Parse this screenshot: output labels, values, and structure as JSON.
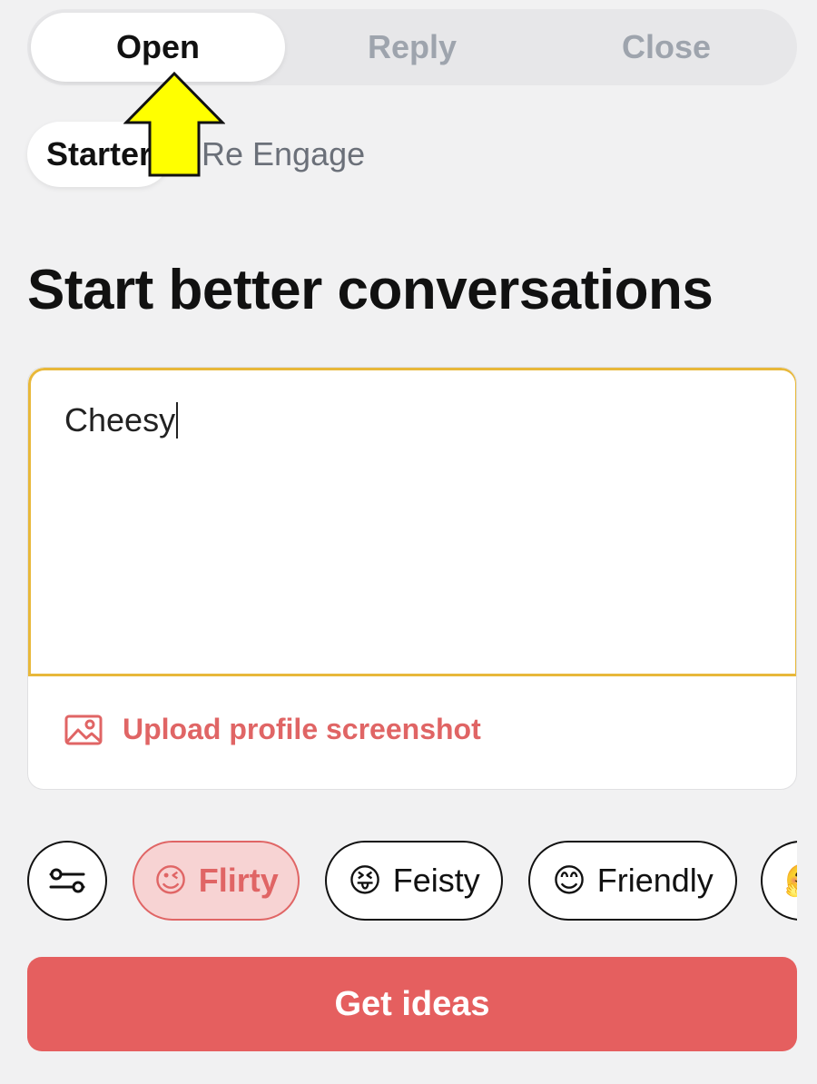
{
  "mode_tabs": [
    {
      "label": "Open",
      "active": true
    },
    {
      "label": "Reply",
      "active": false
    },
    {
      "label": "Close",
      "active": false
    }
  ],
  "sub_tabs": [
    {
      "label": "Starter",
      "active": true
    },
    {
      "label": "Re Engage",
      "active": false
    }
  ],
  "headline": "Start better conversations",
  "input": {
    "value": "Cheesy"
  },
  "upload": {
    "label": "Upload profile screenshot",
    "icon": "image-icon"
  },
  "tones": [
    {
      "emoji": "😉",
      "label": "Flirty",
      "selected": true
    },
    {
      "emoji": "😝",
      "label": "Feisty",
      "selected": false
    },
    {
      "emoji": "😊",
      "label": "Friendly",
      "selected": false
    },
    {
      "emoji": "🤗",
      "label": "",
      "selected": false
    }
  ],
  "settings_icon": "sliders-icon",
  "cta_label": "Get ideas",
  "annotation": {
    "icon": "yellow-arrow-up-icon",
    "color": "#ffff00"
  },
  "colors": {
    "accent": "#e55f5f",
    "input_border": "#e8b83a",
    "selected_chip_bg": "#f7d3d3"
  }
}
